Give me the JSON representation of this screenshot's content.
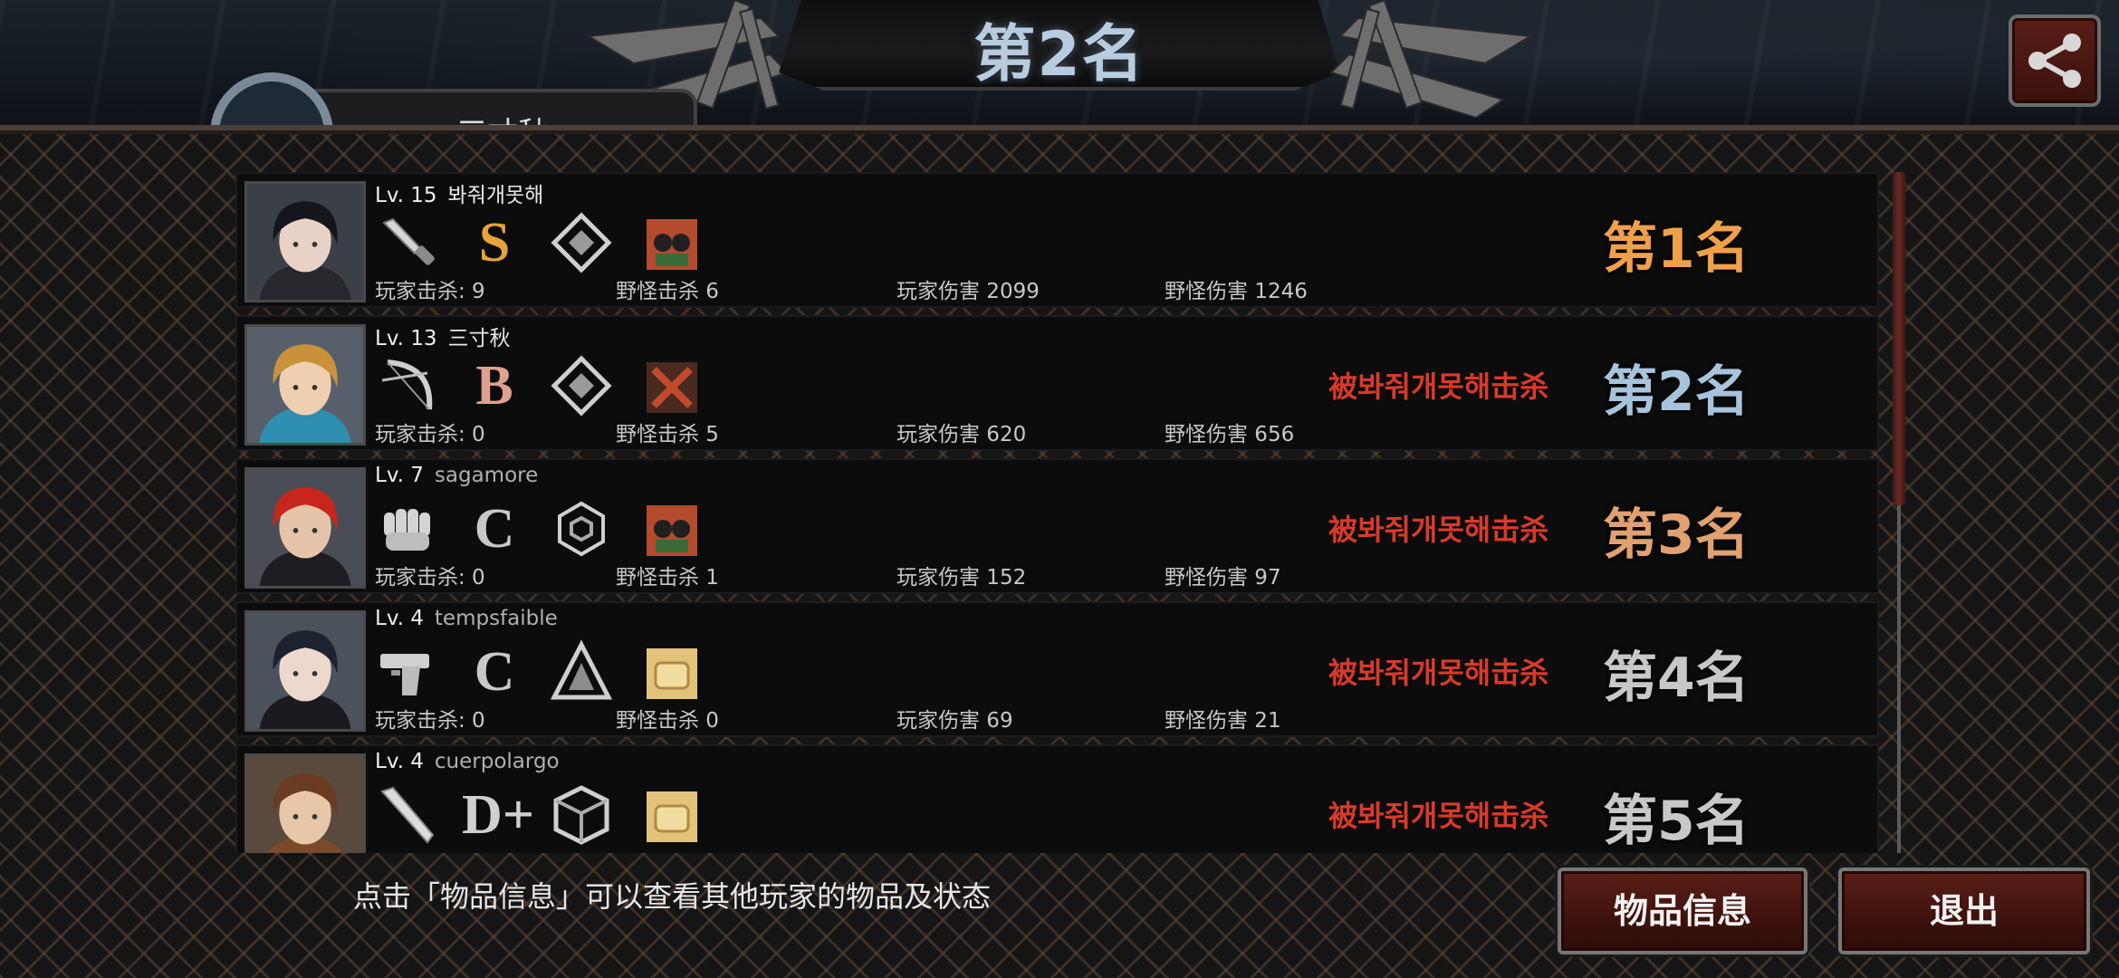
{
  "header": {
    "title": "第2名",
    "player_name_partial": "三寸秋"
  },
  "players": [
    {
      "level": "Lv. 15",
      "name": "봐줘개못해",
      "name_latin": false,
      "weapon": "knife-icon",
      "grade": "S",
      "skill": "diamond-emblem-icon",
      "item": "binoculars-item-icon",
      "player_kills": "玩家击杀: 9",
      "monster_kills": "野怪击杀 6",
      "player_damage": "玩家伤害 2099",
      "monster_damage": "野怪伤害 1246",
      "killed_by": "",
      "rank": "第1名",
      "portrait": {
        "hair": "#15161c",
        "skin": "#e8d2c6",
        "clothes": "#26282e",
        "bg": "#3b4048"
      }
    },
    {
      "level": "Lv. 13",
      "name": "三寸秋",
      "name_latin": false,
      "weapon": "bow-icon",
      "grade": "B",
      "skill": "diamond-emblem-icon",
      "item": "crossed-blades-item-icon",
      "player_kills": "玩家击杀: 0",
      "monster_kills": "野怪击杀 5",
      "player_damage": "玩家伤害 620",
      "monster_damage": "野怪伤害 656",
      "killed_by": "被봐줘개못해击杀",
      "rank": "第2名",
      "portrait": {
        "hair": "#c9913c",
        "skin": "#f0cfb0",
        "clothes": "#2e8fb0",
        "bg": "#57606a"
      }
    },
    {
      "level": "Lv. 7",
      "name": "sagamore",
      "name_latin": true,
      "weapon": "fist-icon",
      "grade": "C",
      "skill": "hexagon-emblem-icon",
      "item": "binoculars-item-icon",
      "player_kills": "玩家击杀: 0",
      "monster_kills": "野怪击杀 1",
      "player_damage": "玩家伤害 152",
      "monster_damage": "野怪伤害 97",
      "killed_by": "被봐줘개못해击杀",
      "rank": "第3名",
      "portrait": {
        "hair": "#c8261c",
        "skin": "#e6c4aa",
        "clothes": "#1e1e22",
        "bg": "#4a4d55"
      }
    },
    {
      "level": "Lv. 4",
      "name": "tempsfaible",
      "name_latin": true,
      "weapon": "pistol-icon",
      "grade": "C",
      "skill": "triangle-emblem-icon",
      "item": "bread-item-icon",
      "player_kills": "玩家击杀: 0",
      "monster_kills": "野怪击杀 0",
      "player_damage": "玩家伤害 69",
      "monster_damage": "野怪伤害 21",
      "killed_by": "被봐줘개못해击杀",
      "rank": "第4名",
      "portrait": {
        "hair": "#1c2230",
        "skin": "#ecd8cc",
        "clothes": "#1b1b1f",
        "bg": "#4c525b"
      }
    },
    {
      "level": "Lv. 4",
      "name": "cuerpolargo",
      "name_latin": true,
      "weapon": "bat-icon",
      "grade": "D+",
      "skill": "cube-emblem-icon",
      "item": "bread-item-icon",
      "player_kills": "",
      "monster_kills": "",
      "player_damage": "",
      "monster_damage": "",
      "killed_by": "被봐줘개못해击杀",
      "rank": "第5名",
      "portrait": {
        "hair": "#6b3a22",
        "skin": "#e8c7a8",
        "clothes": "#7a4a2a",
        "bg": "#5a4a3e"
      }
    }
  ],
  "colors": {
    "rank1": "#f0a04a",
    "rank2": "#a8c4dc",
    "rank3": "#e0a070",
    "rank_other": "#c8c8c8",
    "killed_text": "#d83a2a",
    "grade_S": "#e8a43a",
    "grade_B": "#e0a090",
    "grade_C": "#c8c8c8",
    "grade_D+": "#d0d0d0"
  },
  "footer": {
    "hint": "点击「物品信息」可以查看其他玩家的物品及状态",
    "items_button": "物品信息",
    "exit_button": "退出"
  }
}
